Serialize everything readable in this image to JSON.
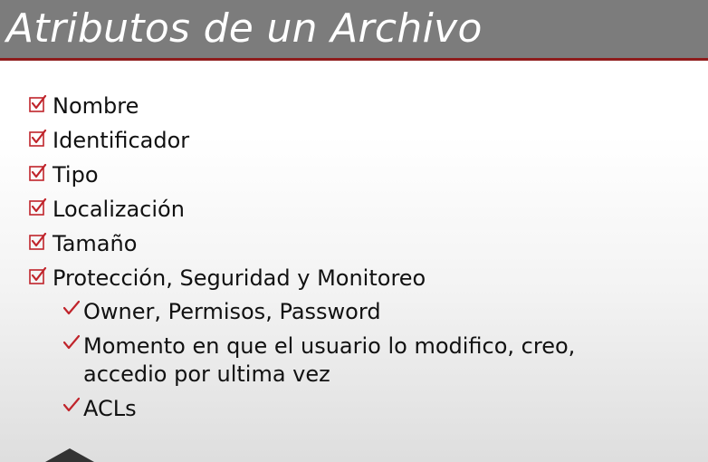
{
  "slide": {
    "title": "Atributos de un Archivo",
    "accent_color": "#c0242b",
    "header_color": "#7c7c7c"
  },
  "bullets": [
    {
      "label": "Nombre",
      "icon": "checkbox-checked-icon"
    },
    {
      "label": "Identificador",
      "icon": "checkbox-checked-icon"
    },
    {
      "label": "Tipo",
      "icon": "checkbox-checked-icon"
    },
    {
      "label": "Localización",
      "icon": "checkbox-checked-icon"
    },
    {
      "label": "Tamaño",
      "icon": "checkbox-checked-icon"
    },
    {
      "label": "Protección, Seguridad y Monitoreo",
      "icon": "checkbox-checked-icon"
    }
  ],
  "sub_bullets": [
    {
      "label": "Owner, Permisos, Password",
      "icon": "checkmark-icon"
    },
    {
      "label": "Momento en que el usuario lo modifico, creo, accedio por ultima vez",
      "icon": "checkmark-icon"
    },
    {
      "label": "ACLs",
      "icon": "checkmark-icon"
    }
  ]
}
